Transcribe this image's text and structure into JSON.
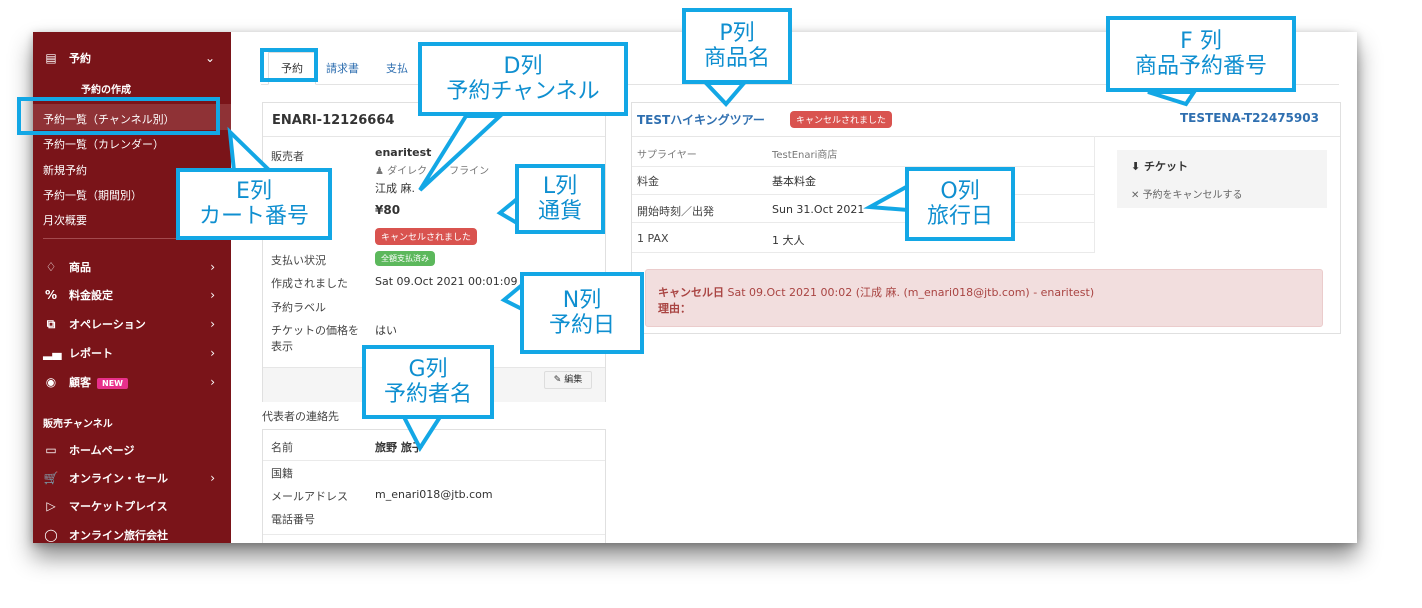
{
  "sidebar": {
    "reservations": "予約",
    "create": "予約の作成",
    "items": [
      {
        "label": "予約一覧（チャンネル別）"
      },
      {
        "label": "予約一覧（カレンダー）"
      },
      {
        "label": "新規予約"
      },
      {
        "label": "予約一覧（期間別）"
      },
      {
        "label": "月次概要"
      }
    ],
    "sections": [
      {
        "label": "商品"
      },
      {
        "label": "料金設定"
      },
      {
        "label": "オペレーション"
      },
      {
        "label": "レポート"
      },
      {
        "label": "顧客"
      }
    ],
    "new_badge": "NEW",
    "channel_heading": "販売チャンネル",
    "channels": [
      {
        "label": "ホームページ"
      },
      {
        "label": "オンライン・セール"
      },
      {
        "label": "マーケットプレイス"
      },
      {
        "label": "オンライン旅行会社"
      }
    ]
  },
  "tabs": [
    "予約",
    "請求書",
    "支払"
  ],
  "booking": {
    "id": "ENARI-12126664",
    "seller_label": "販売者",
    "seller_name": "enaritest",
    "channel_partial": "ダイレク",
    "channel_tail": "フライン",
    "customer": "江成 麻.",
    "amount": "¥80",
    "status_badge": "キャンセルされました",
    "payment_label": "支払い状況",
    "payment_badge": "全額支払済み",
    "created_label": "作成されました",
    "created_value": "Sat 09.Oct 2021 00:01:09",
    "label_label": "予約ラベル",
    "ticket_price_label_1": "チケットの価格を",
    "ticket_price_label_2": "表示",
    "ticket_price_value": "はい",
    "edit_label": "編集"
  },
  "contact": {
    "heading": "代表者の連絡先",
    "name_label": "名前",
    "name_value": "旅野 旅子",
    "nationality_label": "国籍",
    "email_label": "メールアドレス",
    "email_value": "m_enari018@jtb.com",
    "phone_label": "電話番号"
  },
  "product": {
    "name": "TESTハイキングツアー",
    "status_badge": "キャンセルされました",
    "product_booking_id": "TESTENA-T22475903",
    "supplier_label": "サプライヤー",
    "supplier_value": "TestEnari商店",
    "rate_label": "料金",
    "rate_value": "基本料金",
    "start_label": "開始時刻／出発",
    "start_value": "Sun 31.Oct 2021",
    "pax_label": "1 PAX",
    "pax_value": "1 大人"
  },
  "actions": {
    "ticket": "チケット",
    "cancel": "予約をキャンセルする"
  },
  "cancel_notice": {
    "title": "キャンセル日",
    "detail": "Sat 09.Oct 2021 00:02 (江成 麻. (m_enari018@jtb.com) - enaritest)",
    "reason_label": "理由："
  },
  "callouts": {
    "d": [
      "D列",
      "予約チャンネル"
    ],
    "p": [
      "P列",
      "商品名"
    ],
    "f": [
      "F 列",
      "商品予約番号"
    ],
    "e": [
      "E列",
      "カート番号"
    ],
    "l": [
      "L列",
      "通貨"
    ],
    "o": [
      "O列",
      "旅行日"
    ],
    "n": [
      "N列",
      "予約日"
    ],
    "g": [
      "G列",
      "予約者名"
    ]
  },
  "colors": {
    "sidebar_bg": "#7a1419",
    "link": "#2f6fb0",
    "badge_red": "#d9534f",
    "badge_green": "#5cb85c",
    "callout": "#13a7e5"
  }
}
